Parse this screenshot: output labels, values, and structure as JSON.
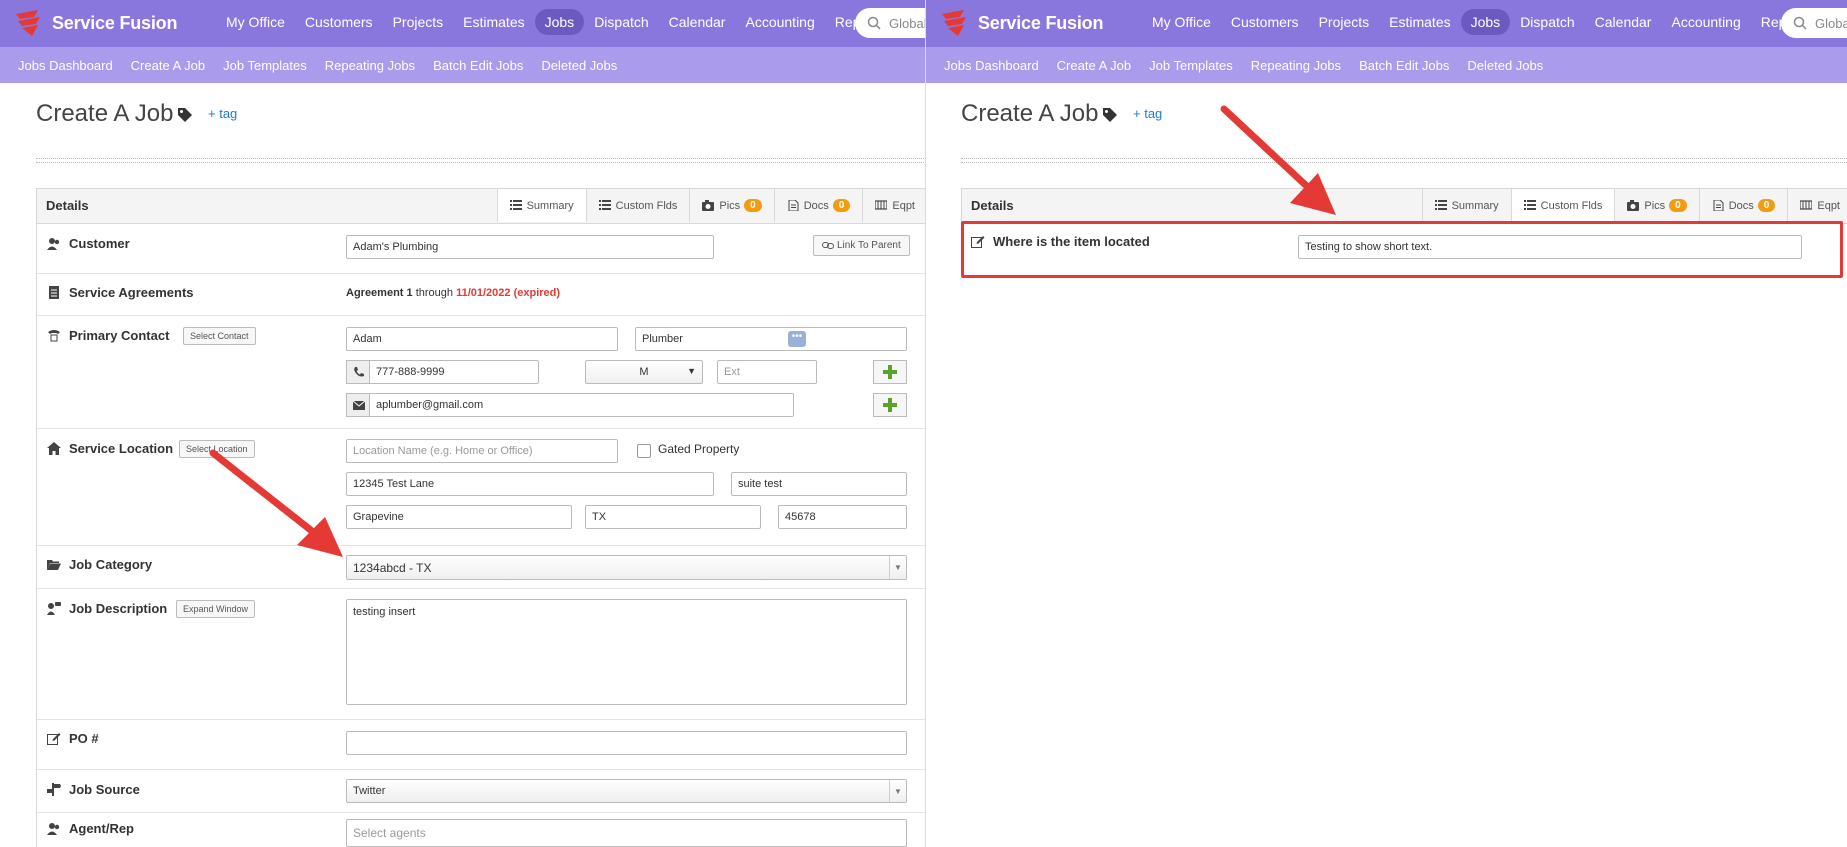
{
  "brand": {
    "name": "Service Fusion"
  },
  "nav": {
    "items": [
      "My Office",
      "Customers",
      "Projects",
      "Estimates",
      "Jobs",
      "Dispatch",
      "Calendar",
      "Accounting",
      "Reports"
    ],
    "active": "Jobs",
    "search_placeholder": "Global Search"
  },
  "subnav": {
    "items": [
      "Jobs Dashboard",
      "Create A Job",
      "Job Templates",
      "Repeating Jobs",
      "Batch Edit Jobs",
      "Deleted Jobs"
    ]
  },
  "page": {
    "title": "Create A Job",
    "add_tag": "+ tag"
  },
  "card": {
    "title": "Details",
    "tabs": {
      "summary": "Summary",
      "custom": "Custom Flds",
      "pics": "Pics",
      "docs": "Docs",
      "eqpt": "Eqpt"
    },
    "pics_count": "0",
    "docs_count": "0"
  },
  "form": {
    "customer": {
      "label": "Customer",
      "value": "Adam's Plumbing",
      "link_parent": "Link To Parent"
    },
    "agreements": {
      "label": "Service Agreements",
      "agreement": "Agreement 1",
      "through": "through",
      "date": "11/01/2022 (expired)"
    },
    "contact": {
      "label": "Primary Contact",
      "select_btn": "Select Contact",
      "first_name": "Adam",
      "last_name": "Plumber",
      "phone": "777-888-9999",
      "phone_type": "M",
      "ext_placeholder": "Ext",
      "email": "aplumber@gmail.com"
    },
    "location": {
      "label": "Service Location",
      "select_btn": "Select Location",
      "name_placeholder": "Location Name (e.g. Home or Office)",
      "gated": "Gated Property",
      "street": "12345 Test Lane",
      "suite": "suite test",
      "city": "Grapevine",
      "state": "TX",
      "zip": "45678"
    },
    "category": {
      "label": "Job Category",
      "value": "1234abcd - TX"
    },
    "description": {
      "label": "Job Description",
      "expand_btn": "Expand Window",
      "value": "testing insert"
    },
    "po": {
      "label": "PO #",
      "value": ""
    },
    "source": {
      "label": "Job Source",
      "value": "Twitter"
    },
    "agent": {
      "label": "Agent/Rep",
      "placeholder": "Select agents"
    }
  },
  "custom_fields": {
    "label": "Where is the item located",
    "value": "Testing to show short text."
  },
  "colors": {
    "nav": "#8a77dd",
    "subnav": "#aa9bed",
    "active_tab": "#6c5ac2",
    "badge": "#f39c12",
    "expired": "#e53935",
    "annotation": "#e53935"
  }
}
